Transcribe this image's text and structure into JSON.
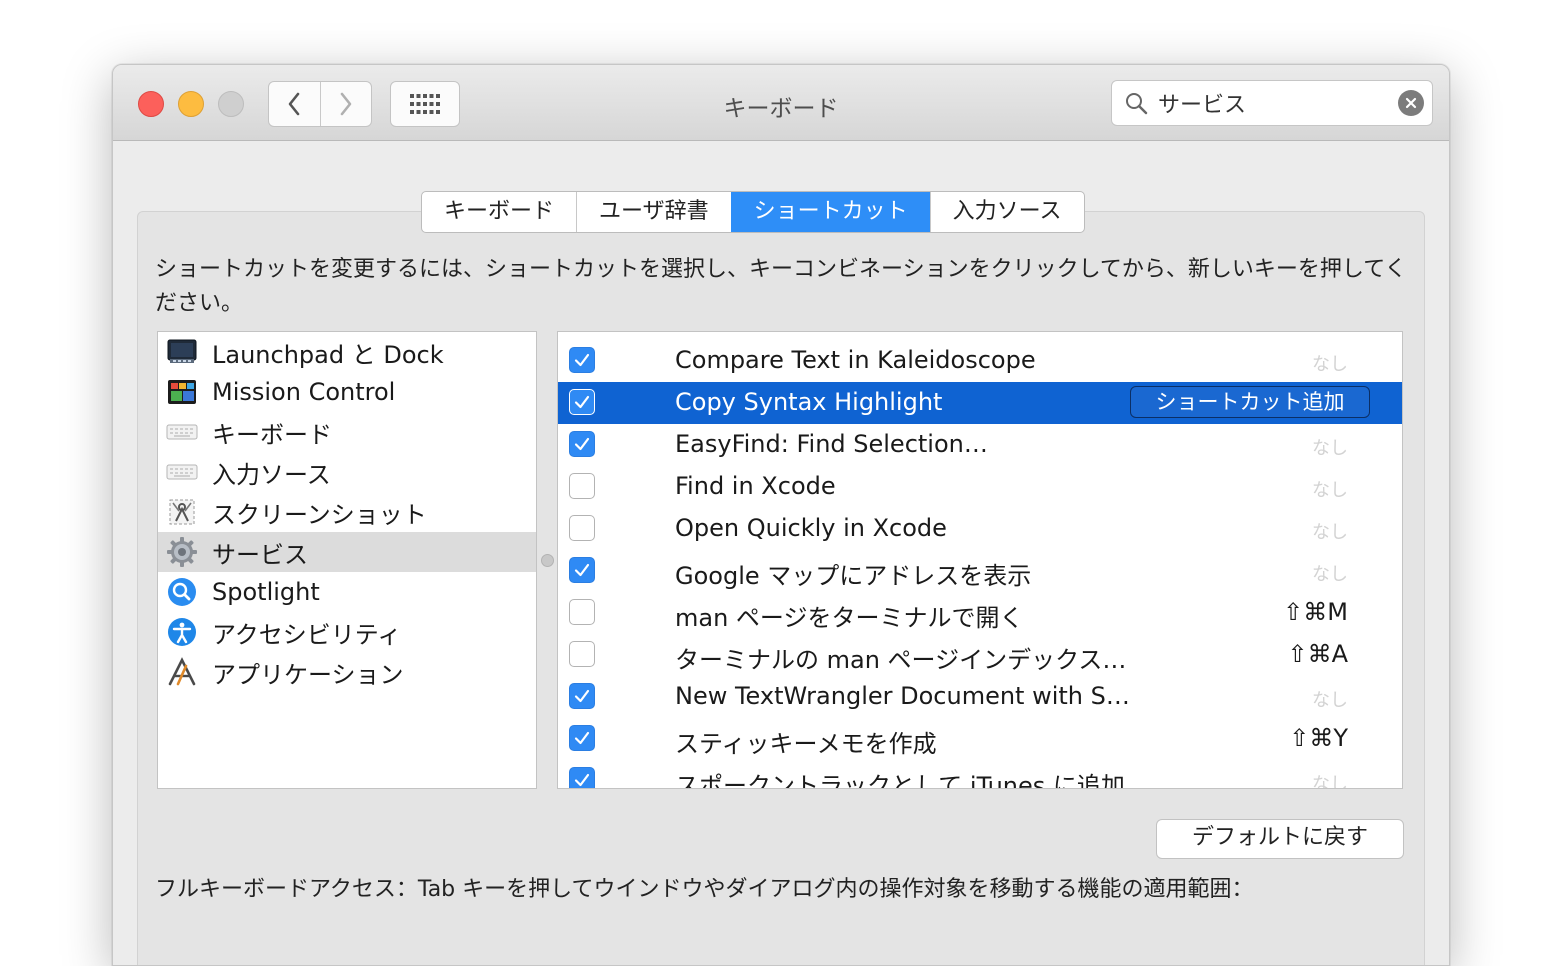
{
  "window": {
    "title": "キーボード"
  },
  "search": {
    "value": "サービス"
  },
  "tabs": [
    {
      "label": "キーボード",
      "active": false
    },
    {
      "label": "ユーザ辞書",
      "active": false
    },
    {
      "label": "ショートカット",
      "active": true
    },
    {
      "label": "入力ソース",
      "active": false
    }
  ],
  "description": "ショートカットを変更するには、ショートカットを選択し、キーコンビネーションをクリックしてから、新しいキーを押してください。",
  "categories": [
    {
      "label": "Launchpad と Dock",
      "icon": "launchpad-icon"
    },
    {
      "label": "Mission Control",
      "icon": "mission-control-icon"
    },
    {
      "label": "キーボード",
      "icon": "keyboard-icon"
    },
    {
      "label": "入力ソース",
      "icon": "keyboard-icon"
    },
    {
      "label": "スクリーンショット",
      "icon": "screenshot-icon"
    },
    {
      "label": "サービス",
      "icon": "gear-icon",
      "selected": true
    },
    {
      "label": "Spotlight",
      "icon": "spotlight-icon"
    },
    {
      "label": "アクセシビリティ",
      "icon": "accessibility-icon"
    },
    {
      "label": "アプリケーション",
      "icon": "app-shortcuts-icon"
    }
  ],
  "shortcuts": [
    {
      "label": "Compare Text in Kaleidoscope",
      "checked": true,
      "key": "なし"
    },
    {
      "label": "Copy Syntax Highlight",
      "checked": true,
      "selected": true,
      "add_button": "ショートカット追加"
    },
    {
      "label": "EasyFind: Find Selection…",
      "checked": true,
      "key": "なし"
    },
    {
      "label": "Find in Xcode",
      "checked": false,
      "key": "なし"
    },
    {
      "label": "Open Quickly in Xcode",
      "checked": false,
      "key": "なし"
    },
    {
      "label": "Google マップにアドレスを表示",
      "checked": true,
      "key": "なし"
    },
    {
      "label": "man ページをターミナルで開く",
      "checked": false,
      "key": "⇧⌘M"
    },
    {
      "label": "ターミナルの man ページインデックス…",
      "checked": false,
      "key": "⇧⌘A"
    },
    {
      "label": "New TextWrangler Document with S…",
      "checked": true,
      "key": "なし"
    },
    {
      "label": "スティッキーメモを作成",
      "checked": true,
      "key": "⇧⌘Y"
    },
    {
      "label": "スポークントラックとして iTunes に追加",
      "checked": true,
      "key": "なし"
    }
  ],
  "default_button": "デフォルトに戻す",
  "full_keyboard_access": "フルキーボードアクセス：Tab キーを押してウインドウやダイアログ内の操作対象を移動する機能の適用範囲："
}
